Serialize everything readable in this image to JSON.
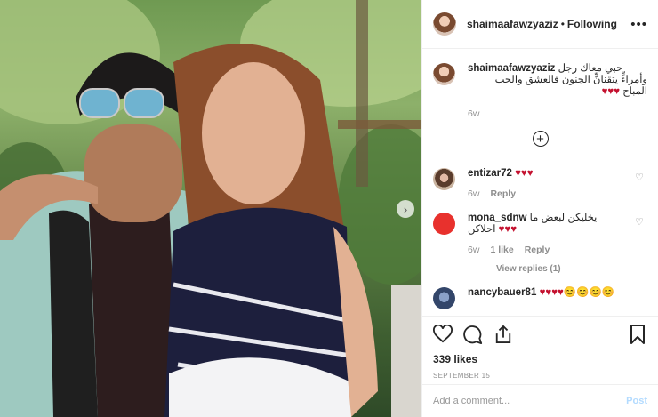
{
  "post": {
    "username": "shaimaafawzyaziz",
    "dot": "•",
    "follow_status": "Following",
    "more_label": "•••"
  },
  "caption": {
    "username": "shaimaafawzyaziz",
    "text_line1": "حبي معاك رجل",
    "text_line2": "وأمراءٍّ يتقنانٍّ الجنون فالعشق والحب",
    "text_line3": "المباح",
    "hearts": "♥♥♥",
    "age": "6w"
  },
  "comments": [
    {
      "username": "entizar72",
      "text": "",
      "hearts": "♥♥♥",
      "age": "6w",
      "likes": "",
      "reply": "Reply"
    },
    {
      "username": "mona_sdnw",
      "text_line1": "يخليكن لبعض ما",
      "text_line2": "احلاكن",
      "hearts": "♥♥♥",
      "age": "6w",
      "likes": "1 like",
      "reply": "Reply",
      "view_replies": "View replies (1)"
    },
    {
      "username": "nancybauer81",
      "hearts": "♥♥♥♥😊😊😊😊"
    }
  ],
  "actions": {
    "likes": "339 likes",
    "date": "SEPTEMBER 15"
  },
  "add_comment": {
    "placeholder": "Add a comment...",
    "post_label": "Post"
  },
  "colors": {
    "heart_red": "#c4112f",
    "post_blue": "#b3dbff",
    "muted_gray": "#8e8e8e"
  }
}
